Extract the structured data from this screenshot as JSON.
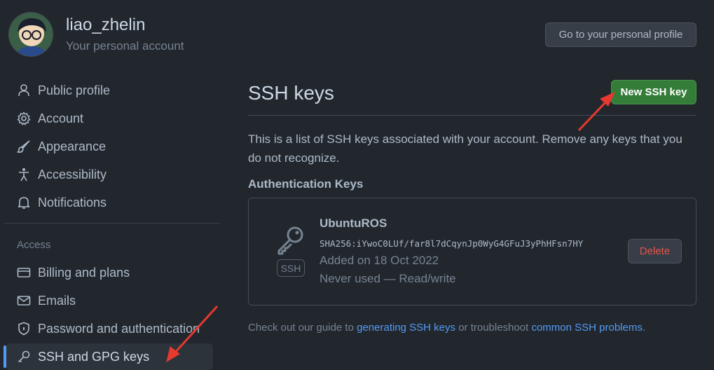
{
  "header": {
    "username": "liao_zhelin",
    "subtitle": "Your personal account",
    "profile_button": "Go to your personal profile"
  },
  "sidebar": {
    "items_top": [
      {
        "label": "Public profile",
        "icon": "person-icon"
      },
      {
        "label": "Account",
        "icon": "gear-icon"
      },
      {
        "label": "Appearance",
        "icon": "paintbrush-icon"
      },
      {
        "label": "Accessibility",
        "icon": "accessibility-icon"
      },
      {
        "label": "Notifications",
        "icon": "bell-icon"
      }
    ],
    "access_heading": "Access",
    "items_access": [
      {
        "label": "Billing and plans",
        "icon": "credit-card-icon"
      },
      {
        "label": "Emails",
        "icon": "mail-icon"
      },
      {
        "label": "Password and authentication",
        "icon": "shield-lock-icon"
      },
      {
        "label": "SSH and GPG keys",
        "icon": "key-icon",
        "active": true
      }
    ]
  },
  "main": {
    "title": "SSH keys",
    "new_key_button": "New SSH key",
    "description": "This is a list of SSH keys associated with your account. Remove any keys that you do not recognize.",
    "section_heading": "Authentication Keys",
    "key": {
      "title": "UbuntuROS",
      "type_badge": "SSH",
      "fingerprint": "SHA256:iYwoC0LUf/far8l7dCqynJp0WyG4GFuJ3yPhHFsn7HY",
      "added": "Added on 18 Oct 2022",
      "usage": "Never used — Read/write",
      "delete_button": "Delete"
    },
    "footer": {
      "prefix": "Check out our guide to",
      "link1": "generating SSH keys",
      "middle": "or troubleshoot",
      "link2": "common SSH problems",
      "suffix": "."
    }
  },
  "colors": {
    "background": "#22272e",
    "primary_button": "#347d39",
    "danger_text": "#e5534b",
    "link": "#539bf5",
    "annotation_arrow": "#e8392f"
  }
}
